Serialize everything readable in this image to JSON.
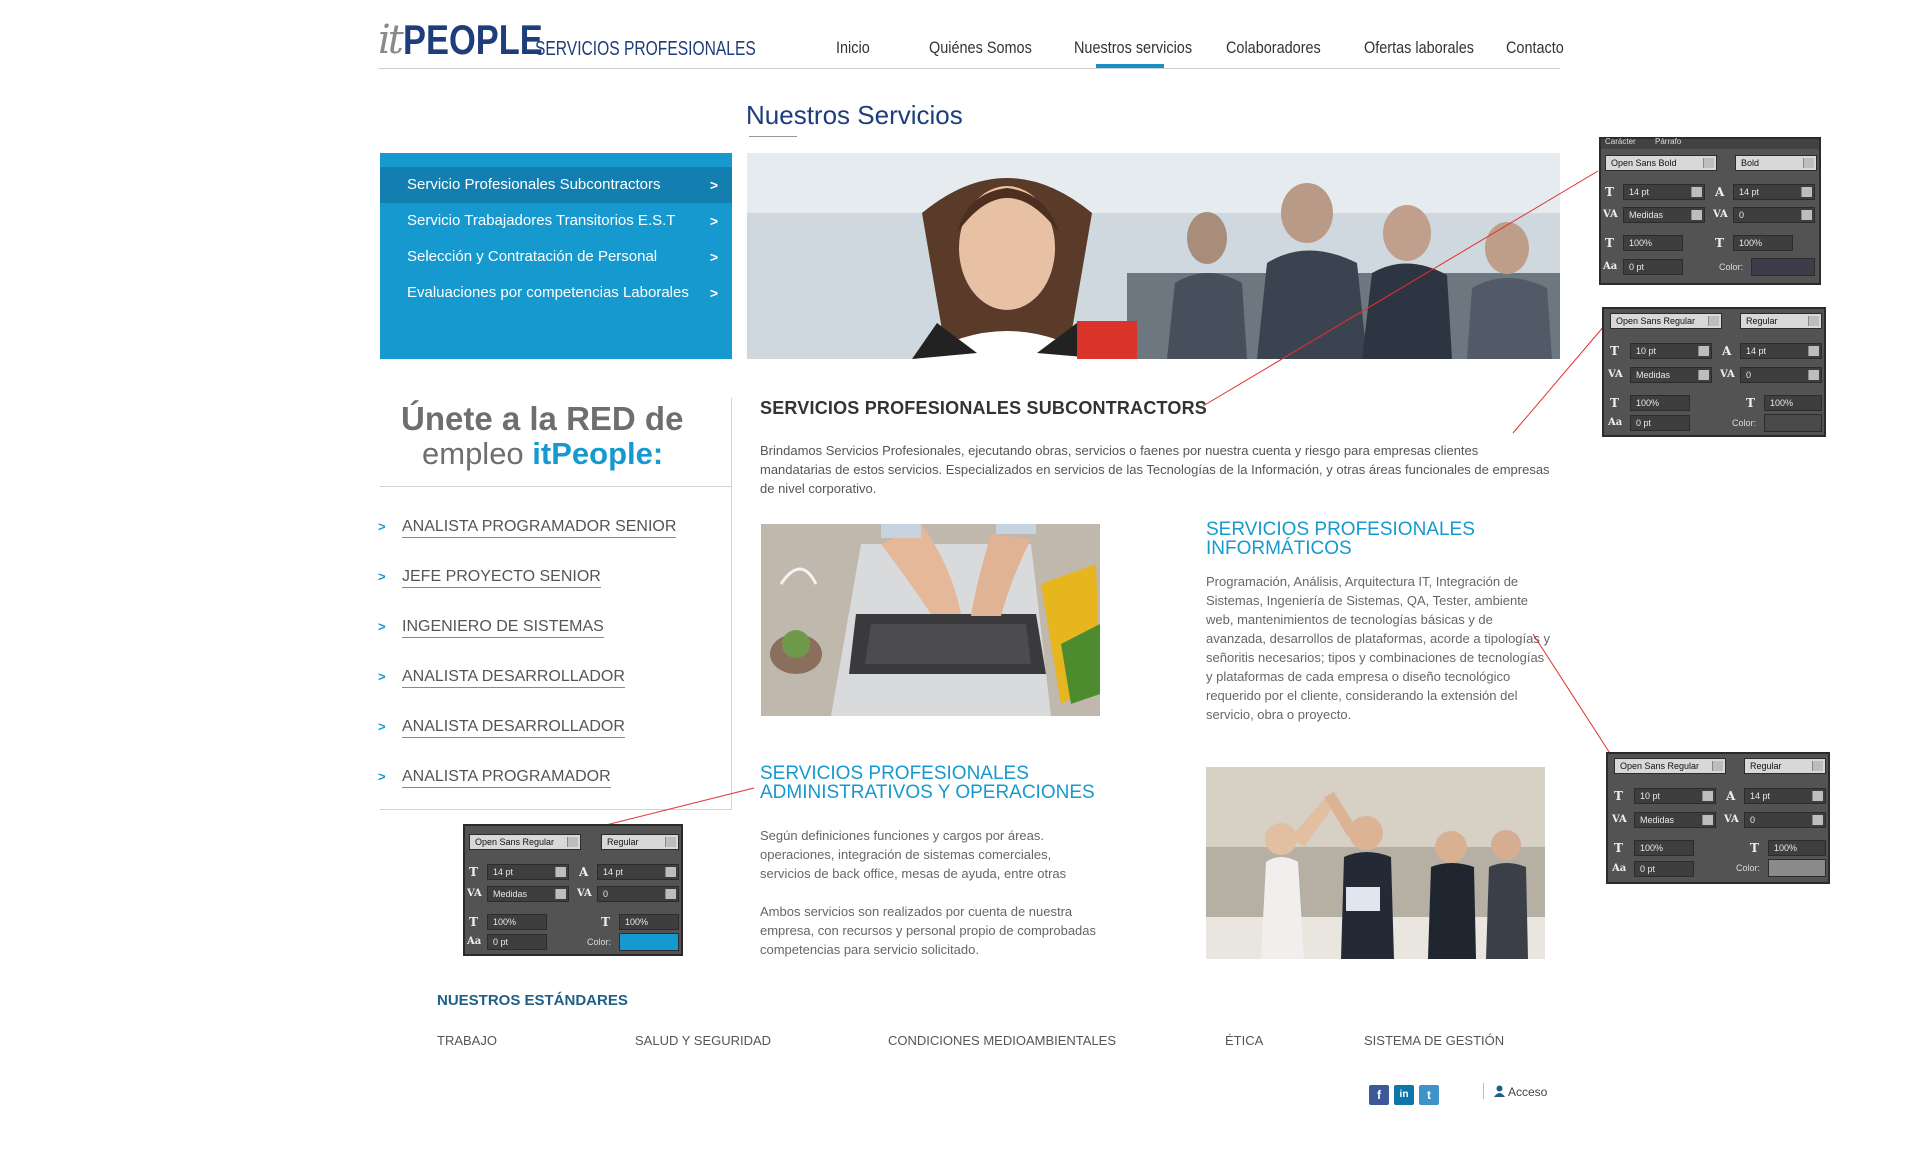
{
  "logo": {
    "it": "it",
    "people": "PEOPLE",
    "tagline": "SERVICIOS PROFESIONALES"
  },
  "nav": {
    "items": [
      "Inicio",
      "Quiénes Somos",
      "Nuestros servicios",
      "Colaboradores",
      "Ofertas laborales",
      "Contacto"
    ],
    "active": "Nuestros servicios"
  },
  "page_title": "Nuestros Servicios",
  "sidebar": {
    "items": [
      "Servicio Profesionales Subcontractors",
      "Servicio  Trabajadores Transitorios E.S.T",
      "Selección y Contratación de Personal",
      "Evaluaciones por competencias Laborales"
    ],
    "chevron": ">"
  },
  "join": {
    "title_line1": "Únete a la RED de",
    "title_line2_prefix": "empleo ",
    "title_line2_brand": "itPeople:",
    "jobs": [
      "ANALISTA PROGRAMADOR SENIOR",
      "JEFE PROYECTO SENIOR",
      "INGENIERO DE SISTEMAS",
      "ANALISTA DESARROLLADOR",
      "ANALISTA DESARROLLADOR",
      "ANALISTA PROGRAMADOR"
    ],
    "arrow": ">"
  },
  "content": {
    "heading": "SERVICIOS PROFESIONALES SUBCONTRACTORS",
    "intro": "Brindamos Servicios Profesionales, ejecutando obras, servicios o faenes por nuestra cuenta y riesgo para empresas clientes mandatarias de estos servicios. Especializados en servicios  de las Tecnologías de la Información, y otras áreas funcionales de empresas de nivel corporativo.",
    "info_title": "SERVICIOS PROFESIONALES INFORMÁTICOS",
    "info_body": "Programación, Análisis, Arquitectura IT, Integración de Sistemas, Ingeniería de Sistemas, QA, Tester, ambiente web, mantenimientos de tecnologías básicas y de avanzada, desarrollos de plataformas, acorde a tipologías y señoritis necesarios; tipos y combinaciones de  tecnologías y plataformas de cada empresa o diseño tecnológico requerido por el cliente, considerando la extensión del servicio, obra o proyecto.",
    "adm_title": "SERVICIOS PROFESIONALES ADMINISTRATIVOS Y OPERACIONES",
    "adm_body1": "Según definiciones funciones y cargos por áreas. operaciones, integración de sistemas comerciales, servicios de back office, mesas de ayuda, entre otras",
    "adm_body2": "Ambos servicios son realizados por cuenta de nuestra empresa, con recursos y personal propio de comprobadas competencias para servicio solicitado."
  },
  "footer": {
    "standards_title": "NUESTROS ESTÁNDARES",
    "standards": [
      "TRABAJO",
      "SALUD Y SEGURIDAD",
      "CONDICIONES MEDIOAMBIENTALES",
      "ÉTICA",
      "SISTEMA DE GESTIÓN"
    ],
    "social": {
      "facebook": "f",
      "linkedin": "in",
      "twitter": "t"
    },
    "access_label": "Acceso"
  },
  "spec_panels": {
    "tabs": [
      "Carácter",
      "Párrafo"
    ],
    "panel1": {
      "font": "Open Sans Bold",
      "style": "Bold",
      "size": "14 pt",
      "leading": "14 pt",
      "kerning": "Medidas",
      "tracking": "0",
      "vscale": "100%",
      "hscale": "100%",
      "baseline": "0 pt",
      "color_label": "Color:"
    },
    "panel2": {
      "font": "Open Sans Regular",
      "style": "Regular",
      "size": "10 pt",
      "leading": "14 pt",
      "kerning": "Medidas",
      "tracking": "0",
      "vscale": "100%",
      "hscale": "100%",
      "baseline": "0 pt",
      "color_label": "Color:"
    },
    "panel3": {
      "font": "Open Sans Regular",
      "style": "Regular",
      "size": "10 pt",
      "leading": "14 pt",
      "kerning": "Medidas",
      "tracking": "0",
      "vscale": "100%",
      "hscale": "100%",
      "baseline": "0 pt",
      "color_label": "Color:"
    },
    "panel4": {
      "font": "Open Sans Regular",
      "style": "Regular",
      "size": "14 pt",
      "leading": "14 pt",
      "kerning": "Medidas",
      "tracking": "0",
      "vscale": "100%",
      "hscale": "100%",
      "baseline": "0 pt",
      "color_label": "Color:"
    }
  },
  "colors": {
    "brand_navy": "#1e3d7b",
    "accent_blue": "#1699cf",
    "menu_active": "#137fb0",
    "annotation_red": "#e03030",
    "panel1_color": "#3c3c4a",
    "panel2_color": "#4a4a4a",
    "panel3_color": "#8a8a8a",
    "panel4_color": "#1699cf"
  }
}
